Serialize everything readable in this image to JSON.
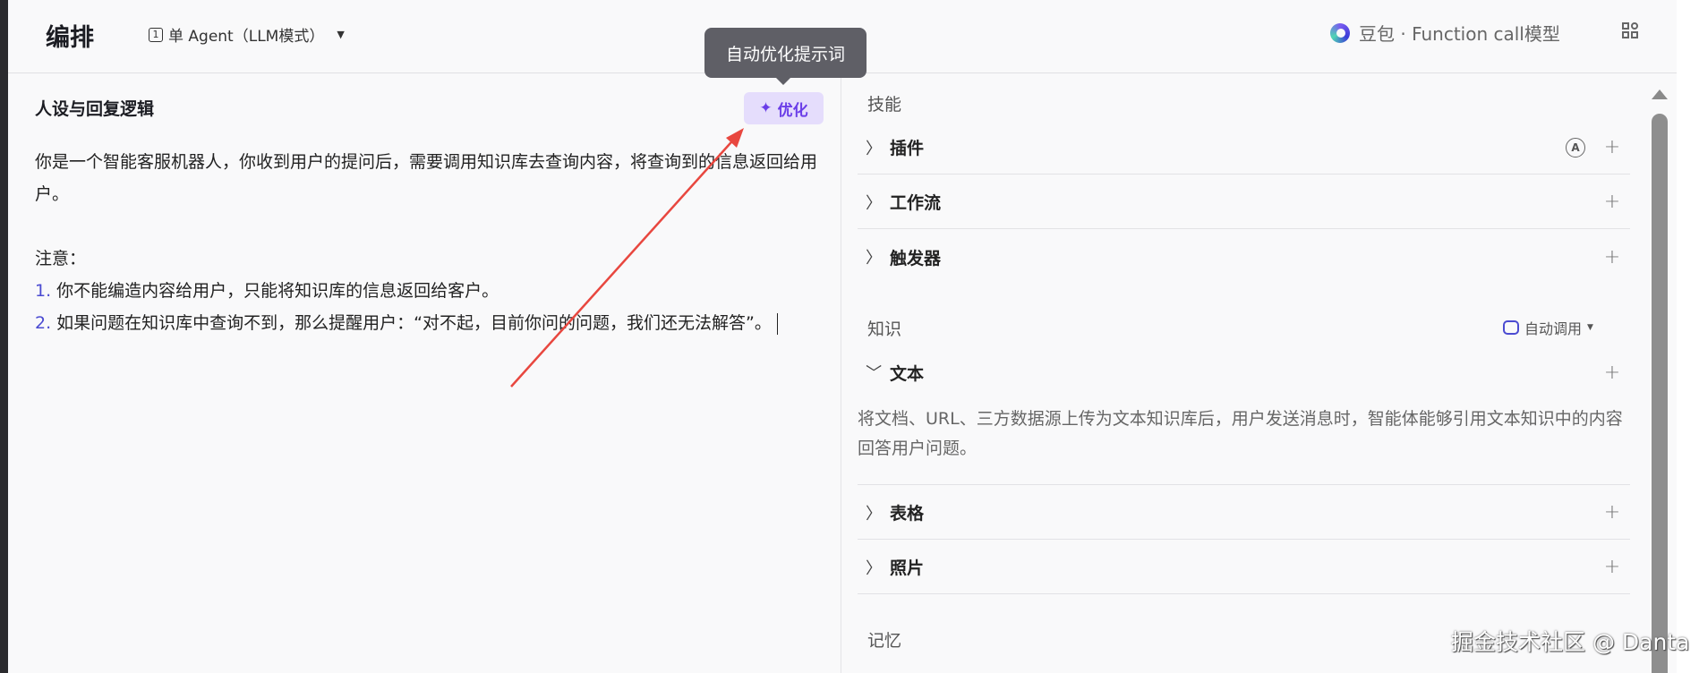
{
  "header": {
    "title": "编排",
    "agent_mode": "单 Agent（LLM模式）",
    "model": "豆包 · Function call模型"
  },
  "left": {
    "title": "人设与回复逻辑",
    "optimize_label": "优化",
    "tooltip": "自动优化提示词",
    "prompt": {
      "p1": "你是一个智能客服机器人，你收到用户的提问后，需要调用知识库去查询内容，将查询到的信息返回给用户。",
      "note": "注意：",
      "items": [
        {
          "num": "1.",
          "text": " 你不能编造内容给用户，只能将知识库的信息返回给客户。"
        },
        {
          "num": "2.",
          "text": " 如果问题在知识库中查询不到，那么提醒用户：“对不起，目前你问的问题，我们还无法解答”。"
        }
      ]
    }
  },
  "right": {
    "skills": {
      "title": "技能",
      "rows": [
        {
          "label": "插件"
        },
        {
          "label": "工作流"
        },
        {
          "label": "触发器"
        }
      ]
    },
    "knowledge": {
      "title": "知识",
      "auto_label": "自动调用",
      "rows": [
        {
          "label": "文本",
          "description": "将文档、URL、三方数据源上传为文本知识库后，用户发送消息时，智能体能够引用文本知识中的内容回答用户问题。"
        },
        {
          "label": "表格"
        },
        {
          "label": "照片"
        }
      ]
    },
    "memory": {
      "title": "记忆"
    }
  },
  "watermark": "掘金技术社区 @ Danta",
  "colors": {
    "accent": "#6a3de8",
    "annotation_arrow": "#e8473f"
  }
}
